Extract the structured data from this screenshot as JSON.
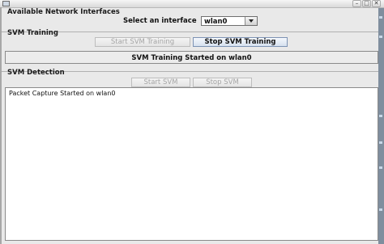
{
  "window": {
    "minimize_glyph": "–",
    "maximize_glyph": "□",
    "close_glyph": "✕"
  },
  "interfaces": {
    "section_title": "Available Network Interfaces",
    "select_label": "Select an interface",
    "selected_interface": "wlan0",
    "dropdown_icon": "chevron-down-icon"
  },
  "training": {
    "section_title": "SVM Training",
    "start_button": "Start SVM Training",
    "stop_button": "Stop SVM Training",
    "status": "SVM Training Started on wlan0"
  },
  "detection": {
    "section_title": "SVM Detection",
    "start_button": "Start SVM",
    "stop_button": "Stop SVM",
    "log": "Packet Capture Started on wlan0"
  }
}
